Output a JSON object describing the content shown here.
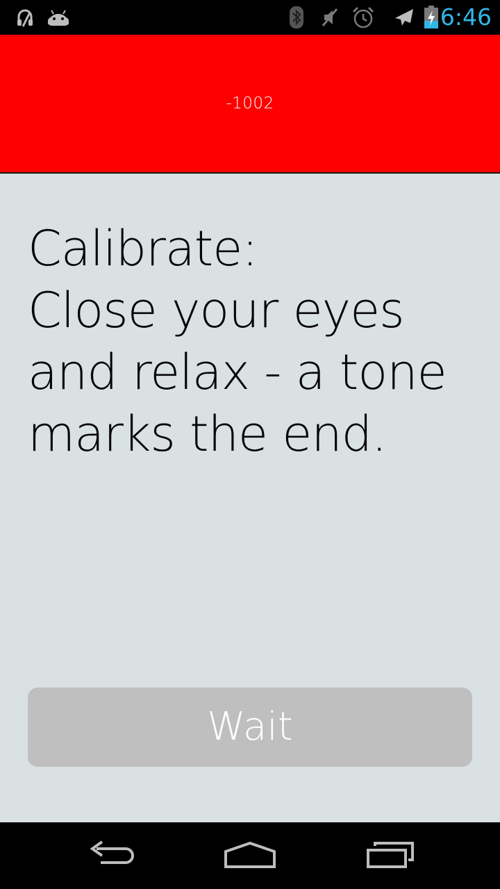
{
  "status_bar": {
    "time": "6:46",
    "time_color": "#33b5e5",
    "left_icons": [
      "headset-icon",
      "android-icon"
    ],
    "right_icons": [
      "bluetooth-icon",
      "mute-icon",
      "alarm-icon",
      "airplane-mode-icon",
      "battery-charging-icon"
    ]
  },
  "header": {
    "value": "-1002",
    "background": "#ff0000"
  },
  "main": {
    "instructions": "Calibrate:\nClose your eyes\nand relax - a tone\nmarks the end.",
    "background": "#d9e1e2"
  },
  "action_button": {
    "label": "Wait",
    "enabled": false
  },
  "nav_bar": {
    "buttons": [
      "back-icon",
      "home-icon",
      "recent-apps-icon"
    ]
  }
}
